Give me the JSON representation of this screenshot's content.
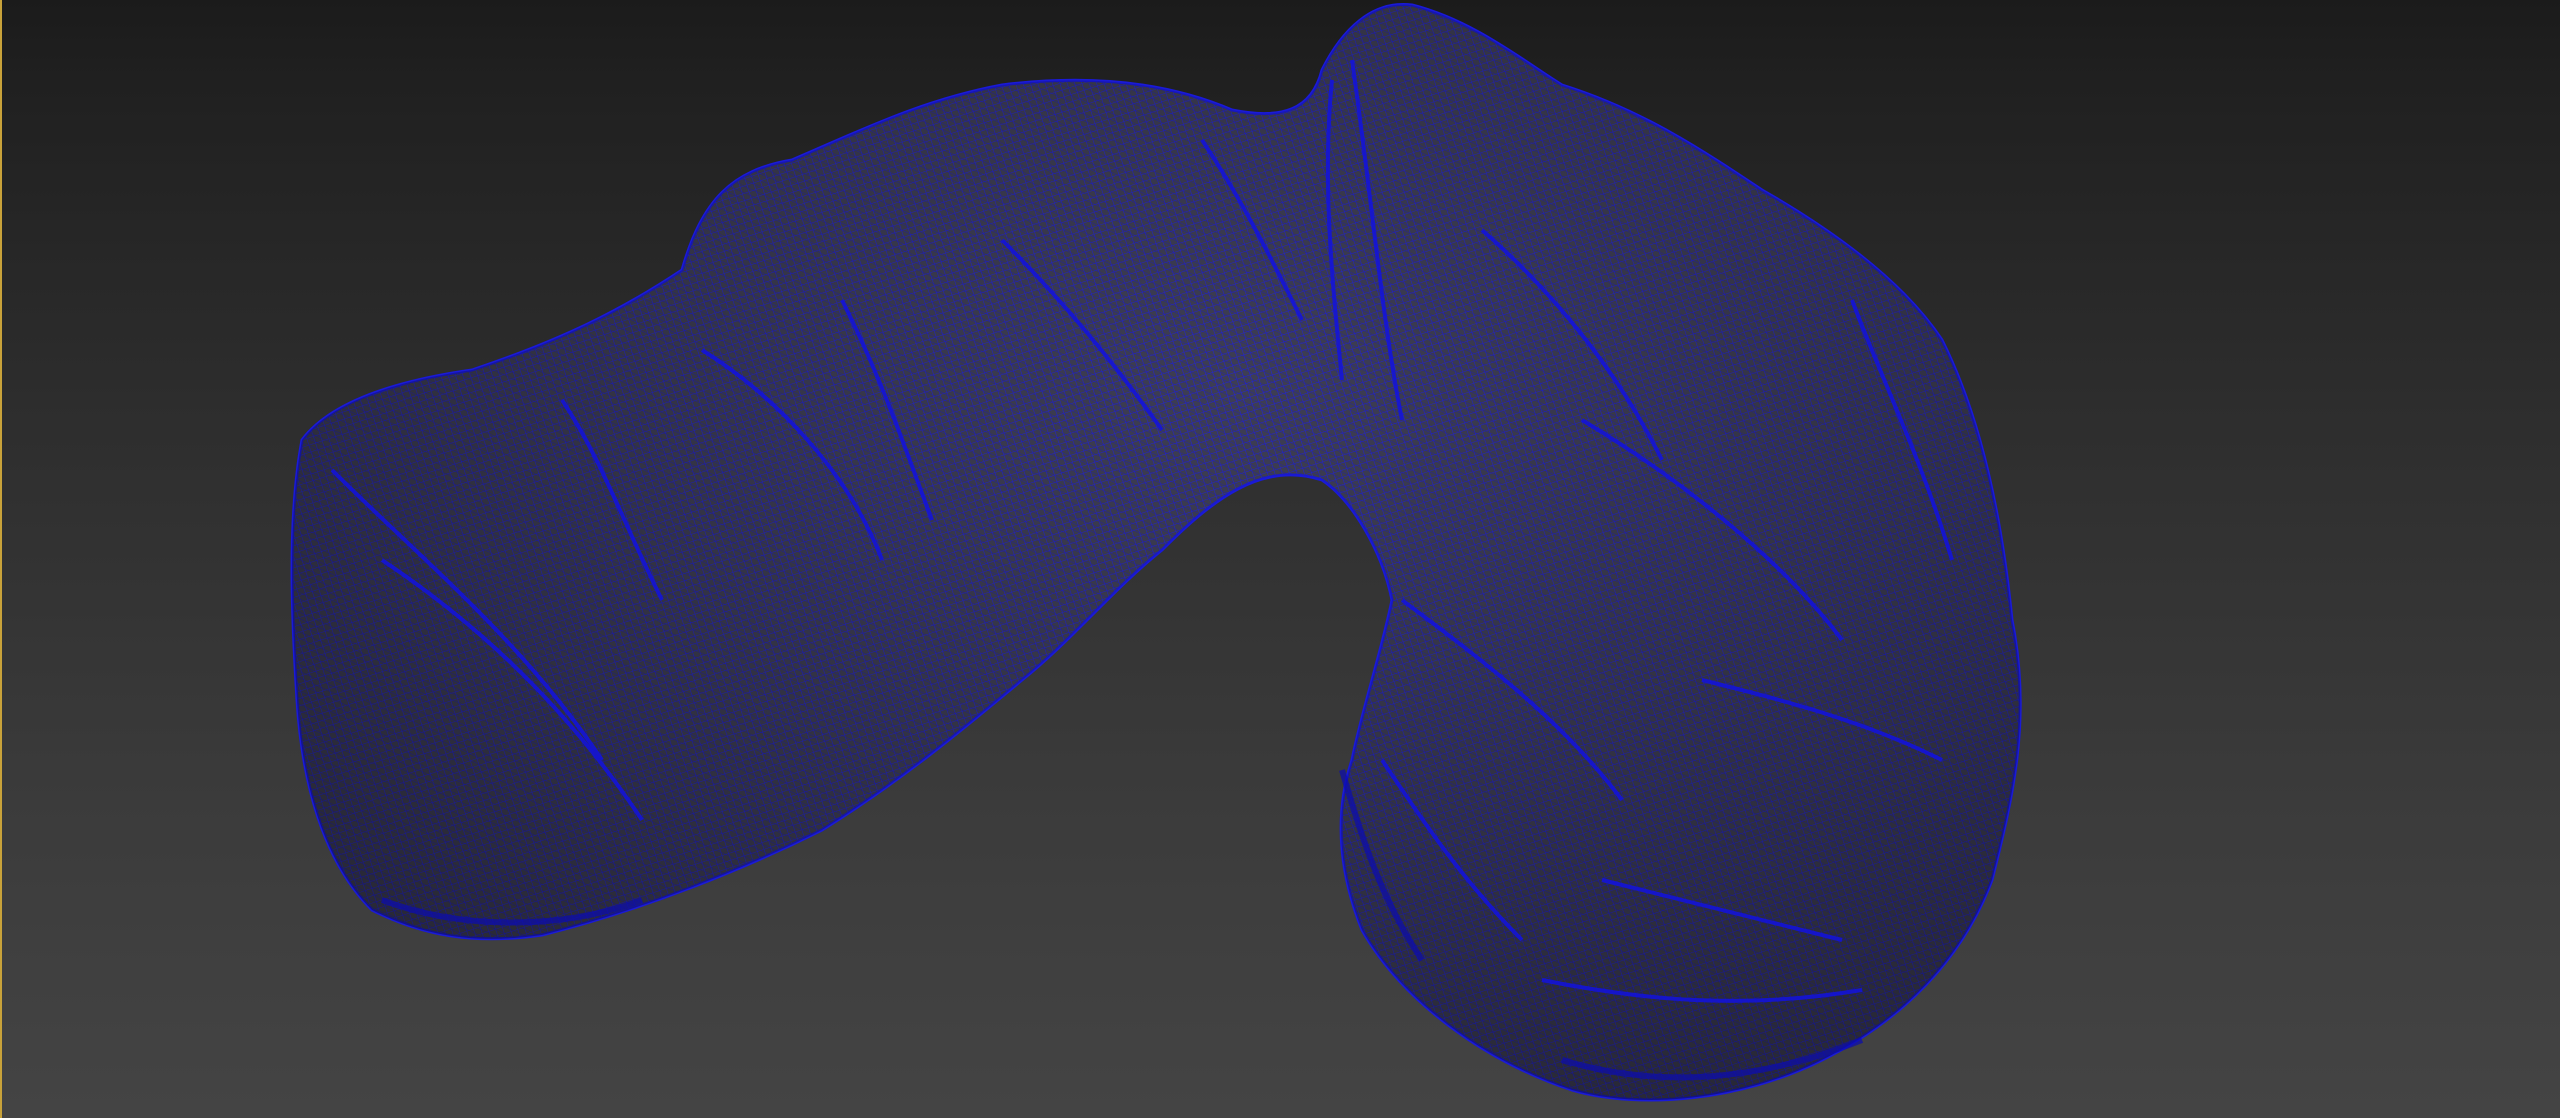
{
  "viewport": {
    "mode": "perspective-wireframe",
    "active_border_color": "#c8a23a",
    "background_top": "#1b1b1b",
    "background_bottom": "#444444"
  },
  "model": {
    "name": "scanned-rock-mesh-icon",
    "wire_color": "#1a1ad0",
    "shade_color": "#4a4a55",
    "display": "wireframe-over-shaded"
  }
}
